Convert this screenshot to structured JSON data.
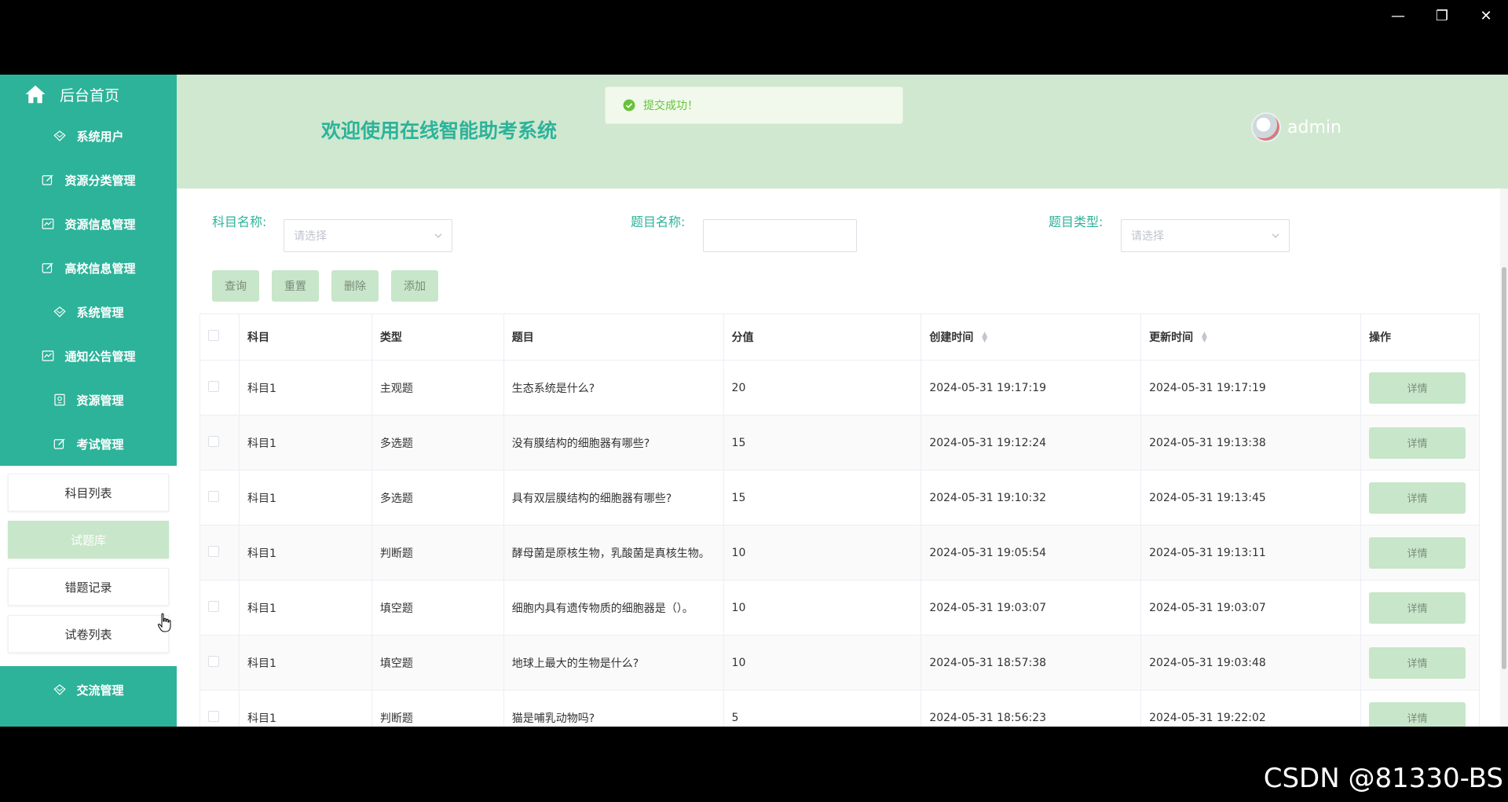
{
  "window": {
    "minimize": "—",
    "restore": "❐",
    "close": "✕"
  },
  "sidebar": {
    "home": "后台首页",
    "items": [
      {
        "label": "系统用户",
        "icon": "diamond-icon"
      },
      {
        "label": "资源分类管理",
        "icon": "edit-icon"
      },
      {
        "label": "资源信息管理",
        "icon": "chart-icon"
      },
      {
        "label": "高校信息管理",
        "icon": "edit-icon"
      },
      {
        "label": "系统管理",
        "icon": "diamond-icon"
      },
      {
        "label": "通知公告管理",
        "icon": "chart-icon"
      },
      {
        "label": "资源管理",
        "icon": "book-icon"
      },
      {
        "label": "考试管理",
        "icon": "edit-icon"
      }
    ],
    "sub_items": [
      {
        "label": "科目列表",
        "active": false
      },
      {
        "label": "试题库",
        "active": true
      },
      {
        "label": "错题记录",
        "active": false
      },
      {
        "label": "试卷列表",
        "active": false
      }
    ],
    "last_item": {
      "label": "交流管理",
      "icon": "diamond-icon"
    }
  },
  "header": {
    "welcome": "欢迎使用在线智能助考系统",
    "toast": "提交成功！",
    "username": "admin"
  },
  "filters": {
    "subject_label": "科目名称:",
    "subject_placeholder": "请选择",
    "question_label": "题目名称:",
    "question_value": "",
    "type_label": "题目类型:",
    "type_placeholder": "请选择"
  },
  "buttons": {
    "query": "查询",
    "reset": "重置",
    "delete": "删除",
    "add": "添加"
  },
  "table": {
    "columns": [
      "科目",
      "类型",
      "题目",
      "分值",
      "创建时间",
      "更新时间",
      "操作"
    ],
    "detail_label": "详情",
    "rows": [
      {
        "subject": "科目1",
        "type": "主观题",
        "question": "生态系统是什么?",
        "score": "20",
        "created": "2024-05-31 19:17:19",
        "updated": "2024-05-31 19:17:19"
      },
      {
        "subject": "科目1",
        "type": "多选题",
        "question": "没有膜结构的细胞器有哪些?",
        "score": "15",
        "created": "2024-05-31 19:12:24",
        "updated": "2024-05-31 19:13:38"
      },
      {
        "subject": "科目1",
        "type": "多选题",
        "question": "具有双层膜结构的细胞器有哪些?",
        "score": "15",
        "created": "2024-05-31 19:10:32",
        "updated": "2024-05-31 19:13:45"
      },
      {
        "subject": "科目1",
        "type": "判断题",
        "question": "酵母菌是原核生物，乳酸菌是真核生物。",
        "score": "10",
        "created": "2024-05-31 19:05:54",
        "updated": "2024-05-31 19:13:11"
      },
      {
        "subject": "科目1",
        "type": "填空题",
        "question": "细胞内具有遗传物质的细胞器是（）。",
        "score": "10",
        "created": "2024-05-31 19:03:07",
        "updated": "2024-05-31 19:03:07"
      },
      {
        "subject": "科目1",
        "type": "填空题",
        "question": "地球上最大的生物是什么?",
        "score": "10",
        "created": "2024-05-31 18:57:38",
        "updated": "2024-05-31 19:03:48"
      },
      {
        "subject": "科目1",
        "type": "判断题",
        "question": "猫是哺乳动物吗?",
        "score": "5",
        "created": "2024-05-31 18:56:23",
        "updated": "2024-05-31 19:22:02"
      }
    ]
  },
  "watermark": "CSDN @81330-BS",
  "colors": {
    "accent": "#2db39a",
    "header_bg": "#d0e8d0",
    "button_bg": "#c8e6c9",
    "success": "#67c23a"
  }
}
